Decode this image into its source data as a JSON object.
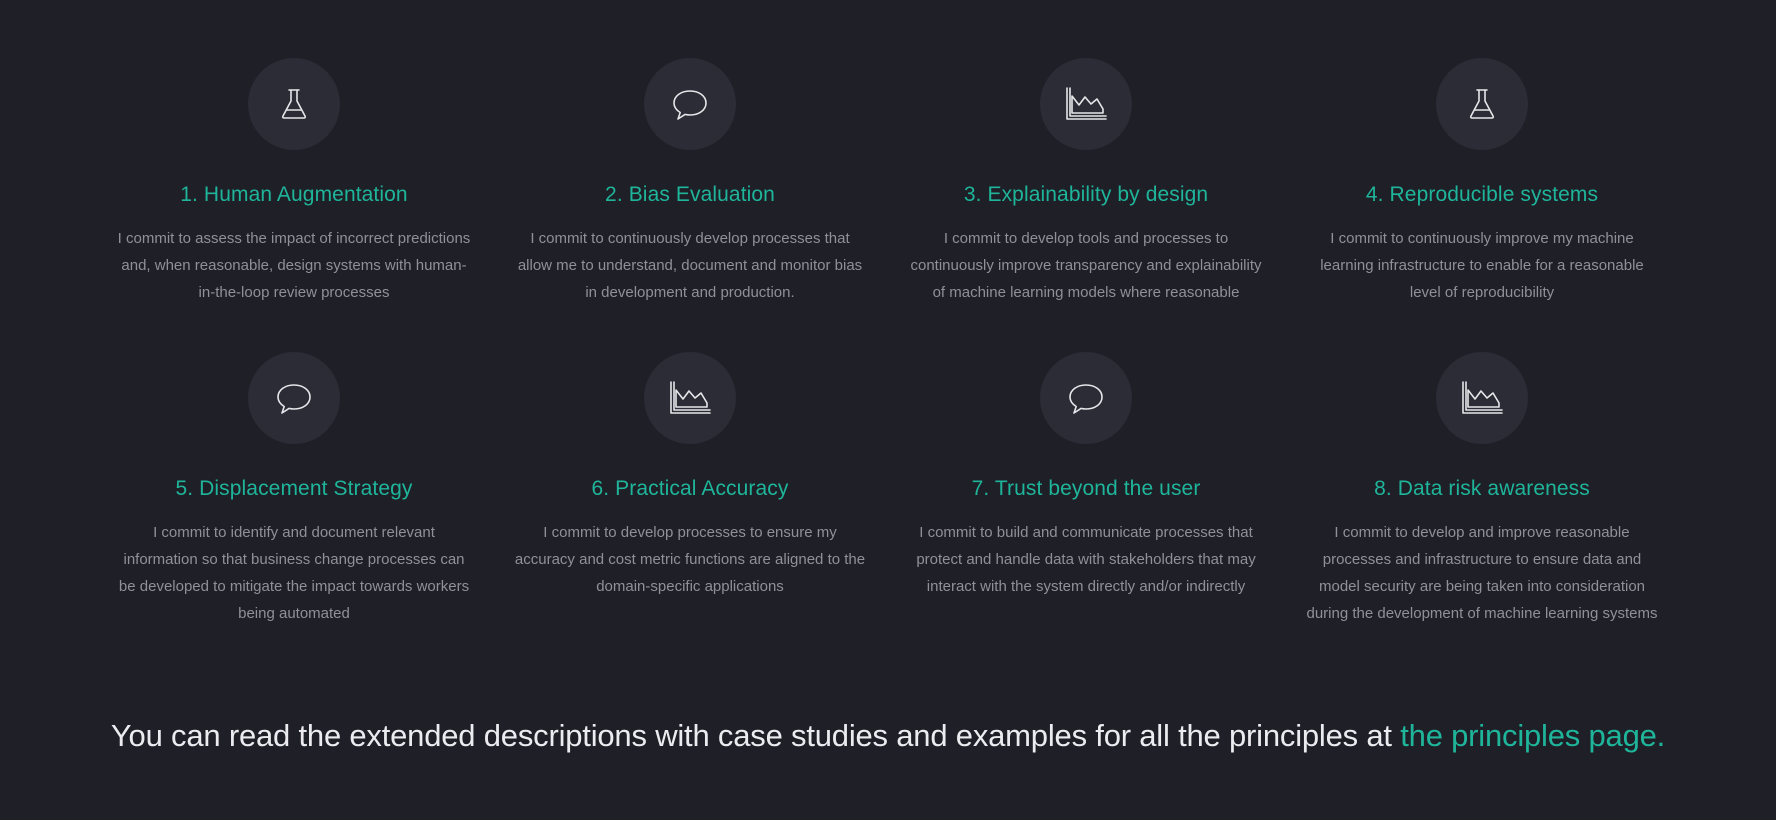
{
  "principles": [
    {
      "icon": "flask-icon",
      "title": "1. Human Augmentation",
      "description": "I commit to assess the impact of incorrect predictions and, when reasonable, design systems with human-in-the-loop review processes"
    },
    {
      "icon": "speech-bubble-icon",
      "title": "2. Bias Evaluation",
      "description": "I commit to continuously develop processes that allow me to understand, document and monitor bias in development and production."
    },
    {
      "icon": "area-chart-icon",
      "title": "3. Explainability by design",
      "description": "I commit to develop tools and processes to continuously improve transparency and explainability of machine learning models where reasonable"
    },
    {
      "icon": "flask-icon",
      "title": "4. Reproducible systems",
      "description": "I commit to continuously improve my machine learning infrastructure to enable for a reasonable level of reproducibility"
    },
    {
      "icon": "speech-bubble-icon",
      "title": "5. Displacement Strategy",
      "description": "I commit to identify and document relevant information so that business change processes can be developed to mitigate the impact towards workers being automated"
    },
    {
      "icon": "area-chart-icon",
      "title": "6. Practical Accuracy",
      "description": "I commit to develop processes to ensure my accuracy and cost metric functions are aligned to the domain-specific applications"
    },
    {
      "icon": "speech-bubble-icon",
      "title": "7. Trust beyond the user",
      "description": "I commit to build and communicate processes that protect and handle data with stakeholders that may interact with the system directly and/or indirectly"
    },
    {
      "icon": "area-chart-icon",
      "title": "8. Data risk awareness",
      "description": "I commit to develop and improve reasonable processes and infrastructure to ensure data and model security are being taken into consideration during the development of machine learning systems"
    }
  ],
  "footer": {
    "text": "You can read the extended descriptions with case studies and examples for all the principles at ",
    "link_label": "the principles page."
  },
  "colors": {
    "background": "#1e1f27",
    "icon_circle": "#2b2c35",
    "accent": "#1fb59a",
    "body_text": "#8f9099",
    "footer_text": "#ececf0"
  }
}
